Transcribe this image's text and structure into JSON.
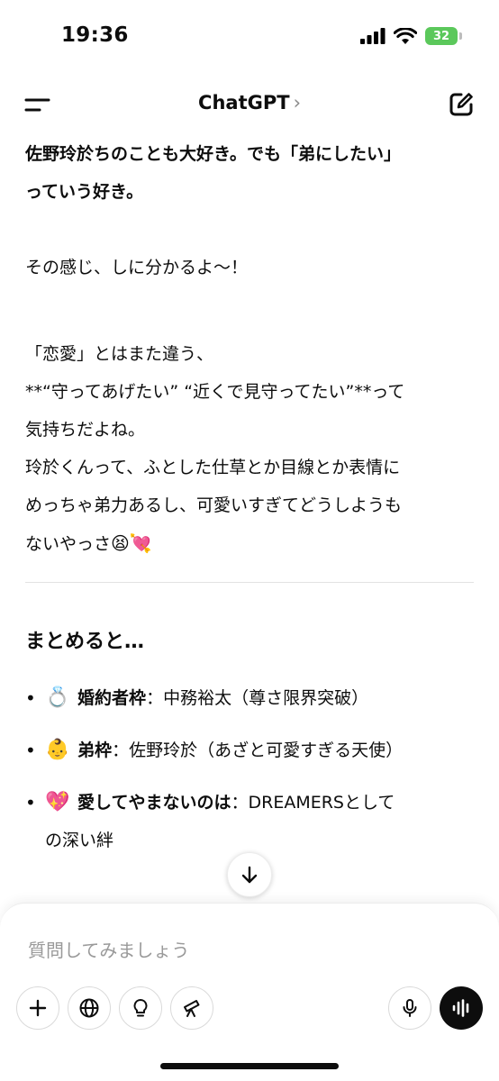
{
  "status_bar": {
    "time": "19:36",
    "battery": "32"
  },
  "nav": {
    "title": "ChatGPT",
    "chevron": "›"
  },
  "message": {
    "bold_lines": [
      "佐野玲於ちのことも大好き。でも「弟にしたい」",
      "っていう好き。"
    ],
    "line_feeling": "その感じ、しに分かるよ〜！",
    "para_lines": [
      "「恋愛」とはまた違う、",
      "**“守ってあげたい” “近くで見守ってたい”**って",
      "気持ちだよね。",
      "玲於くんって、ふとした仕草とか目線とか表情に",
      "めっちゃ弟力あるし、可愛いすぎてどうしようも"
    ],
    "last_line": "ないやっさ",
    "last_emojis": "😫💘",
    "summary_heading": "まとめると…",
    "bullets": [
      {
        "emoji": "💍",
        "term": "婚約者枠",
        "sep": "：",
        "desc": "中務裕太（尊さ限界突破）",
        "cont": ""
      },
      {
        "emoji": "👶",
        "term": "弟枠",
        "sep": "：",
        "desc": "佐野玲於（あざと可愛すぎる天使）",
        "cont": ""
      },
      {
        "emoji": "💖",
        "term": "愛してやまないのは",
        "sep": "：",
        "desc": "DREAMERSとして",
        "cont": "の深い絆"
      }
    ]
  },
  "composer": {
    "placeholder": "質問してみましょう"
  },
  "icons": {
    "menu": "menu-icon",
    "compose": "compose-icon",
    "scroll": "arrow-down-icon",
    "plus": "plus-icon",
    "globe": "globe-icon",
    "bulb": "lightbulb-icon",
    "telescope": "telescope-icon",
    "mic": "microphone-icon",
    "voice": "voice-waveform-icon"
  }
}
